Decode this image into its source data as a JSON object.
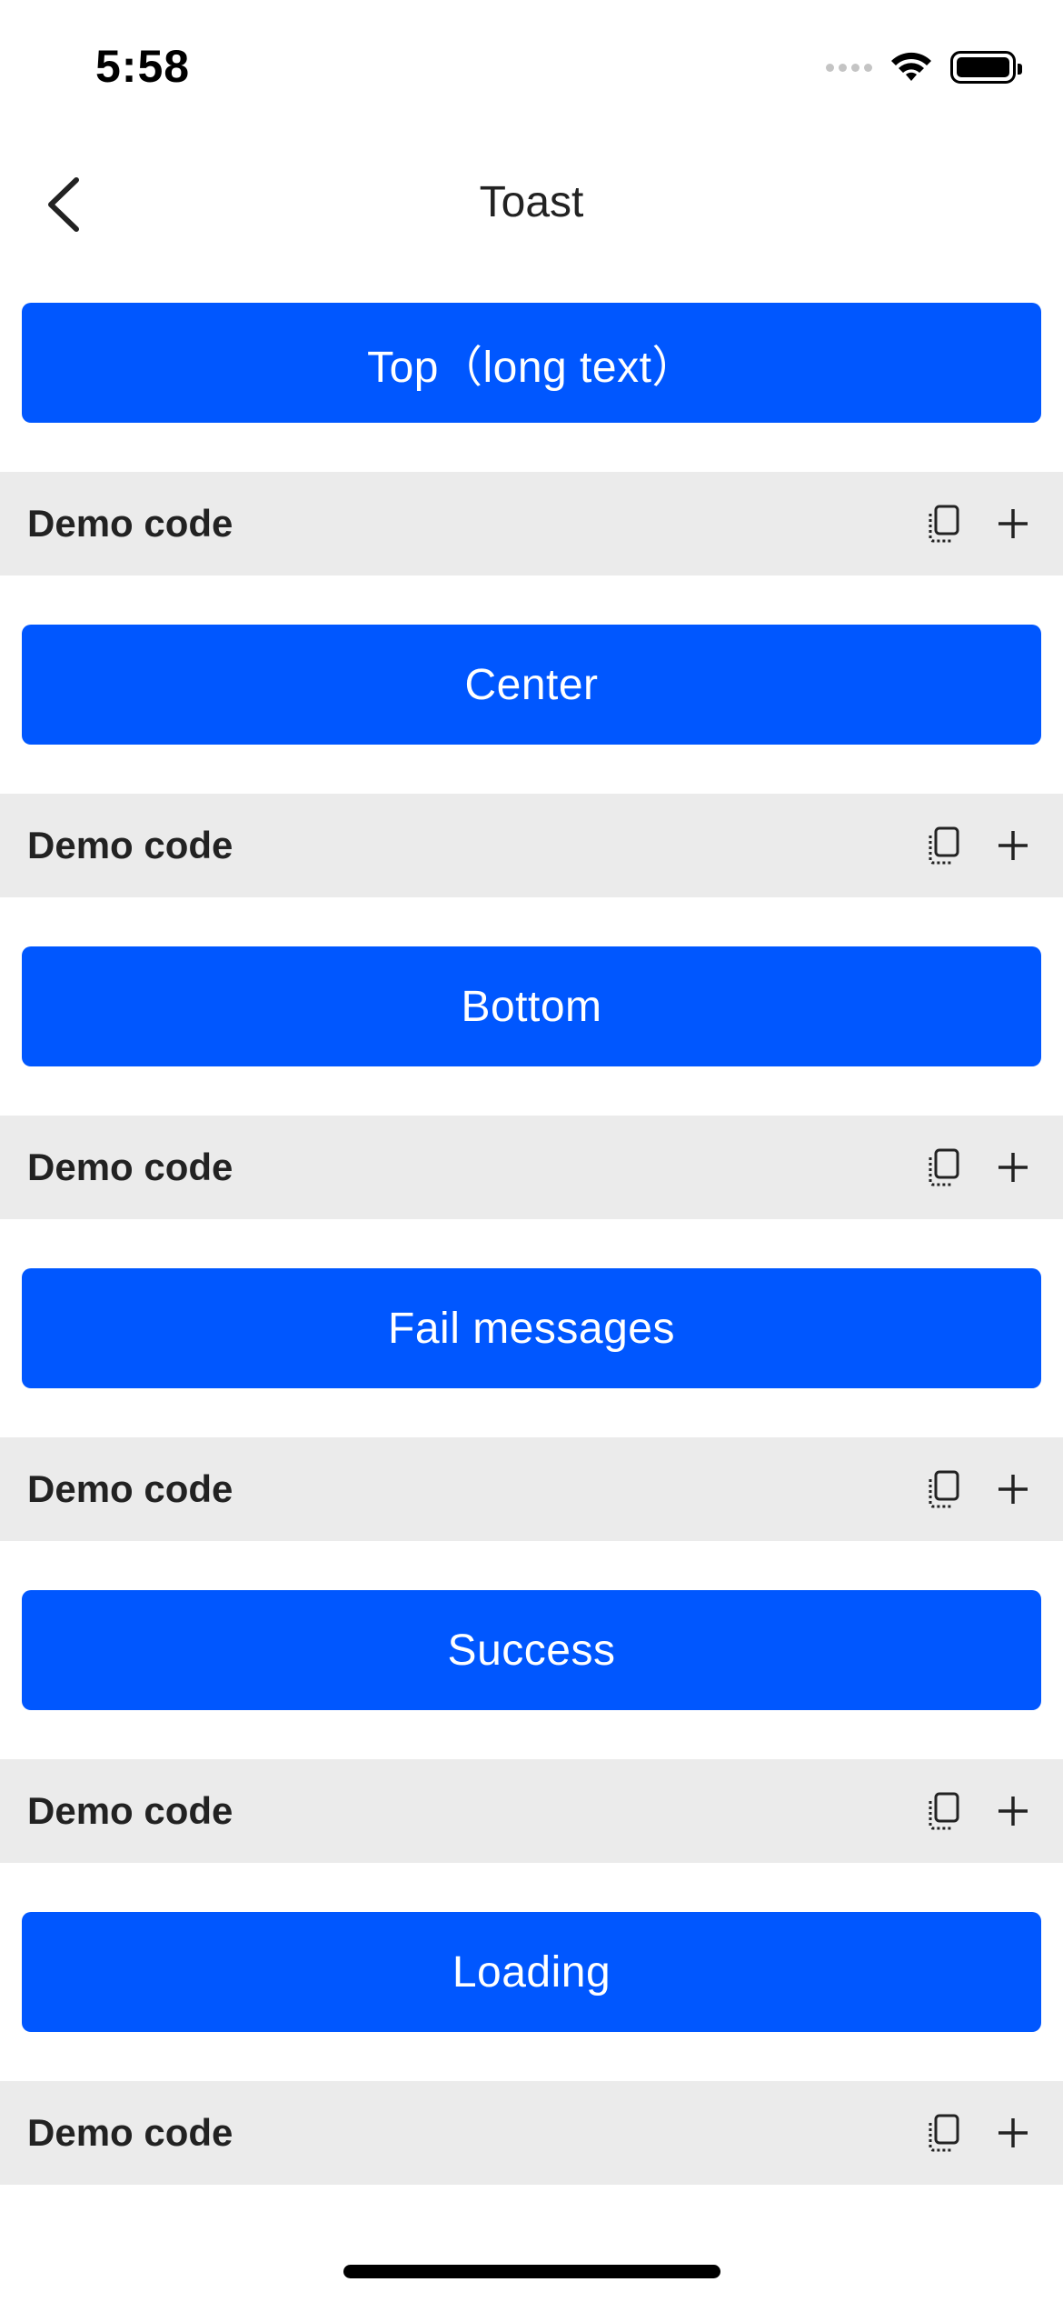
{
  "status_bar": {
    "time": "5:58",
    "icons": [
      "signal-dots-icon",
      "wifi-icon",
      "battery-icon"
    ]
  },
  "nav": {
    "title": "Toast",
    "back_icon": "chevron-left-icon"
  },
  "colors": {
    "accent": "#0057ff",
    "code_bar_bg": "#ebebeb",
    "text": "#222222"
  },
  "sections": [
    {
      "button_label": "Top（long text）",
      "code_label": "Demo code"
    },
    {
      "button_label": "Center",
      "code_label": "Demo code"
    },
    {
      "button_label": "Bottom",
      "code_label": "Demo code"
    },
    {
      "button_label": "Fail messages",
      "code_label": "Demo code"
    },
    {
      "button_label": "Success",
      "code_label": "Demo code"
    },
    {
      "button_label": "Loading",
      "code_label": "Demo code"
    }
  ],
  "code_bar_icons": [
    "copy-icon",
    "plus-icon"
  ]
}
